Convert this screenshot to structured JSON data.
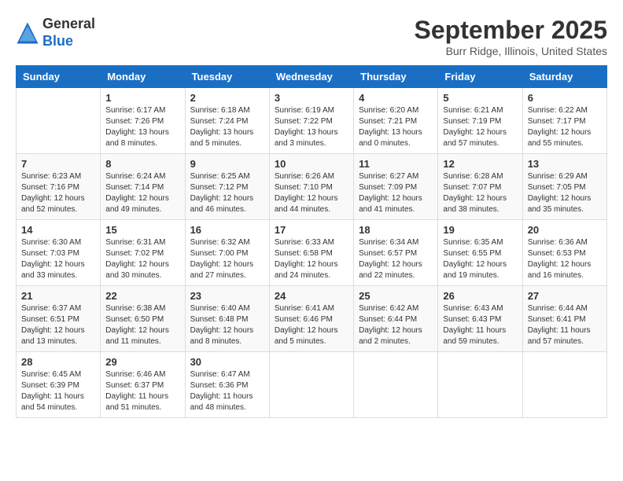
{
  "logo": {
    "general": "General",
    "blue": "Blue"
  },
  "header": {
    "month_title": "September 2025",
    "location": "Burr Ridge, Illinois, United States"
  },
  "days_of_week": [
    "Sunday",
    "Monday",
    "Tuesday",
    "Wednesday",
    "Thursday",
    "Friday",
    "Saturday"
  ],
  "weeks": [
    [
      {
        "day": "",
        "info": ""
      },
      {
        "day": "1",
        "info": "Sunrise: 6:17 AM\nSunset: 7:26 PM\nDaylight: 13 hours\nand 8 minutes."
      },
      {
        "day": "2",
        "info": "Sunrise: 6:18 AM\nSunset: 7:24 PM\nDaylight: 13 hours\nand 5 minutes."
      },
      {
        "day": "3",
        "info": "Sunrise: 6:19 AM\nSunset: 7:22 PM\nDaylight: 13 hours\nand 3 minutes."
      },
      {
        "day": "4",
        "info": "Sunrise: 6:20 AM\nSunset: 7:21 PM\nDaylight: 13 hours\nand 0 minutes."
      },
      {
        "day": "5",
        "info": "Sunrise: 6:21 AM\nSunset: 7:19 PM\nDaylight: 12 hours\nand 57 minutes."
      },
      {
        "day": "6",
        "info": "Sunrise: 6:22 AM\nSunset: 7:17 PM\nDaylight: 12 hours\nand 55 minutes."
      }
    ],
    [
      {
        "day": "7",
        "info": "Sunrise: 6:23 AM\nSunset: 7:16 PM\nDaylight: 12 hours\nand 52 minutes."
      },
      {
        "day": "8",
        "info": "Sunrise: 6:24 AM\nSunset: 7:14 PM\nDaylight: 12 hours\nand 49 minutes."
      },
      {
        "day": "9",
        "info": "Sunrise: 6:25 AM\nSunset: 7:12 PM\nDaylight: 12 hours\nand 46 minutes."
      },
      {
        "day": "10",
        "info": "Sunrise: 6:26 AM\nSunset: 7:10 PM\nDaylight: 12 hours\nand 44 minutes."
      },
      {
        "day": "11",
        "info": "Sunrise: 6:27 AM\nSunset: 7:09 PM\nDaylight: 12 hours\nand 41 minutes."
      },
      {
        "day": "12",
        "info": "Sunrise: 6:28 AM\nSunset: 7:07 PM\nDaylight: 12 hours\nand 38 minutes."
      },
      {
        "day": "13",
        "info": "Sunrise: 6:29 AM\nSunset: 7:05 PM\nDaylight: 12 hours\nand 35 minutes."
      }
    ],
    [
      {
        "day": "14",
        "info": "Sunrise: 6:30 AM\nSunset: 7:03 PM\nDaylight: 12 hours\nand 33 minutes."
      },
      {
        "day": "15",
        "info": "Sunrise: 6:31 AM\nSunset: 7:02 PM\nDaylight: 12 hours\nand 30 minutes."
      },
      {
        "day": "16",
        "info": "Sunrise: 6:32 AM\nSunset: 7:00 PM\nDaylight: 12 hours\nand 27 minutes."
      },
      {
        "day": "17",
        "info": "Sunrise: 6:33 AM\nSunset: 6:58 PM\nDaylight: 12 hours\nand 24 minutes."
      },
      {
        "day": "18",
        "info": "Sunrise: 6:34 AM\nSunset: 6:57 PM\nDaylight: 12 hours\nand 22 minutes."
      },
      {
        "day": "19",
        "info": "Sunrise: 6:35 AM\nSunset: 6:55 PM\nDaylight: 12 hours\nand 19 minutes."
      },
      {
        "day": "20",
        "info": "Sunrise: 6:36 AM\nSunset: 6:53 PM\nDaylight: 12 hours\nand 16 minutes."
      }
    ],
    [
      {
        "day": "21",
        "info": "Sunrise: 6:37 AM\nSunset: 6:51 PM\nDaylight: 12 hours\nand 13 minutes."
      },
      {
        "day": "22",
        "info": "Sunrise: 6:38 AM\nSunset: 6:50 PM\nDaylight: 12 hours\nand 11 minutes."
      },
      {
        "day": "23",
        "info": "Sunrise: 6:40 AM\nSunset: 6:48 PM\nDaylight: 12 hours\nand 8 minutes."
      },
      {
        "day": "24",
        "info": "Sunrise: 6:41 AM\nSunset: 6:46 PM\nDaylight: 12 hours\nand 5 minutes."
      },
      {
        "day": "25",
        "info": "Sunrise: 6:42 AM\nSunset: 6:44 PM\nDaylight: 12 hours\nand 2 minutes."
      },
      {
        "day": "26",
        "info": "Sunrise: 6:43 AM\nSunset: 6:43 PM\nDaylight: 11 hours\nand 59 minutes."
      },
      {
        "day": "27",
        "info": "Sunrise: 6:44 AM\nSunset: 6:41 PM\nDaylight: 11 hours\nand 57 minutes."
      }
    ],
    [
      {
        "day": "28",
        "info": "Sunrise: 6:45 AM\nSunset: 6:39 PM\nDaylight: 11 hours\nand 54 minutes."
      },
      {
        "day": "29",
        "info": "Sunrise: 6:46 AM\nSunset: 6:37 PM\nDaylight: 11 hours\nand 51 minutes."
      },
      {
        "day": "30",
        "info": "Sunrise: 6:47 AM\nSunset: 6:36 PM\nDaylight: 11 hours\nand 48 minutes."
      },
      {
        "day": "",
        "info": ""
      },
      {
        "day": "",
        "info": ""
      },
      {
        "day": "",
        "info": ""
      },
      {
        "day": "",
        "info": ""
      }
    ]
  ]
}
